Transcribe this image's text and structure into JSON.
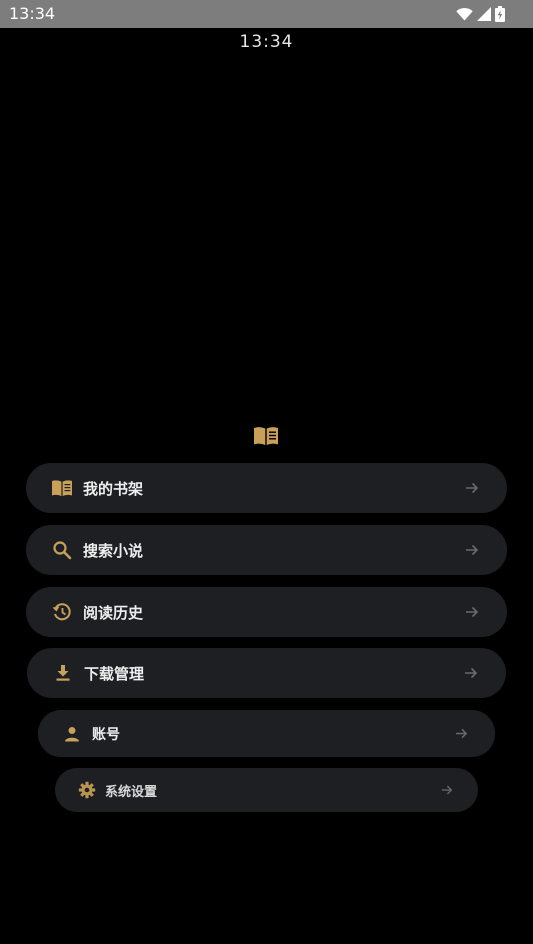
{
  "status_bar": {
    "time": "13:34",
    "icons": [
      "wifi-icon",
      "signal-icon",
      "battery-charging-icon"
    ],
    "background": "#7d7d7d"
  },
  "clock": {
    "time": "13:34"
  },
  "logo": {
    "icon": "open-book-icon",
    "color": "#c8a05a"
  },
  "menu": {
    "accent": "#c8a05a",
    "item_background": "#1e1f23",
    "arrow_color": "#6a6a6a",
    "items": [
      {
        "label": "我的书架",
        "icon": "book-icon"
      },
      {
        "label": "搜索小说",
        "icon": "search-icon"
      },
      {
        "label": "阅读历史",
        "icon": "history-icon"
      },
      {
        "label": "下载管理",
        "icon": "download-icon"
      },
      {
        "label": "账号",
        "icon": "person-icon"
      },
      {
        "label": "系统设置",
        "icon": "gear-icon"
      }
    ]
  }
}
